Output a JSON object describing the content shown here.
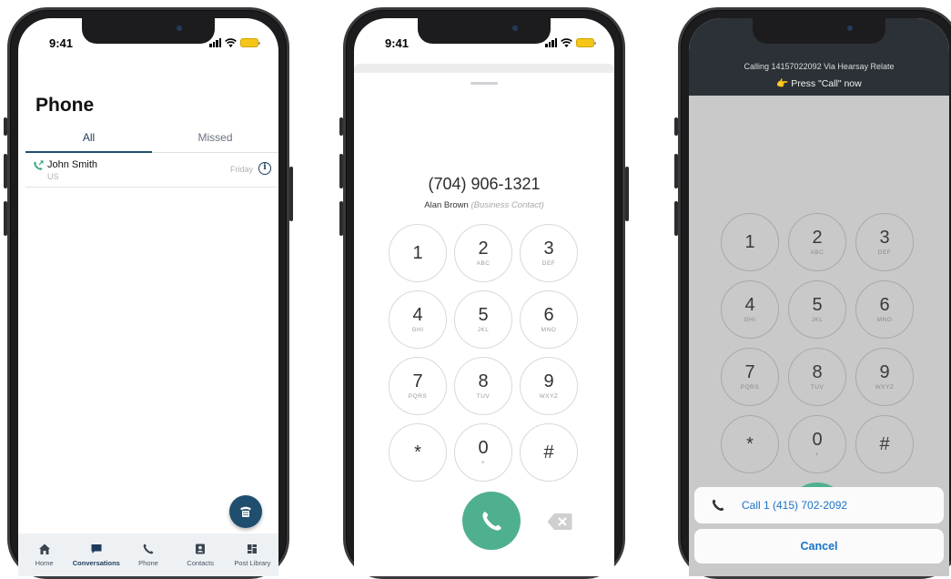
{
  "screen1": {
    "time": "9:41",
    "title": "Phone",
    "tabs": [
      {
        "label": "All"
      },
      {
        "label": "Missed"
      }
    ],
    "calls": [
      {
        "name": "John Smith",
        "subtitle": "US",
        "day": "Friday"
      }
    ],
    "fab_icon": "dialpad-icon",
    "nav": [
      {
        "label": "Home",
        "icon": "home-icon"
      },
      {
        "label": "Conversations",
        "icon": "chat-icon"
      },
      {
        "label": "Phone",
        "icon": "phone-icon"
      },
      {
        "label": "Contacts",
        "icon": "contacts-icon"
      },
      {
        "label": "Post Library",
        "icon": "grid-icon"
      }
    ],
    "active_nav": "Conversations",
    "accent": "#1d4f6e"
  },
  "screen2": {
    "time": "9:41",
    "number": "(704) 906-1321",
    "contact_name": "Alan Brown",
    "contact_type": "(Business Contact)",
    "keys": [
      {
        "d": "1",
        "l": ""
      },
      {
        "d": "2",
        "l": "ABC"
      },
      {
        "d": "3",
        "l": "DEF"
      },
      {
        "d": "4",
        "l": "GHI"
      },
      {
        "d": "5",
        "l": "JKL"
      },
      {
        "d": "6",
        "l": "MNO"
      },
      {
        "d": "7",
        "l": "PQRS"
      },
      {
        "d": "8",
        "l": "TUV"
      },
      {
        "d": "9",
        "l": "WXYZ"
      },
      {
        "d": "*",
        "l": ""
      },
      {
        "d": "0",
        "l": "+"
      },
      {
        "d": "#",
        "l": ""
      }
    ],
    "call_color": "#4fb08f"
  },
  "screen3": {
    "calling_text": "Calling 14157022092 Via Hearsay Relate",
    "press_text": "👉 Press \"Call\" now",
    "keys": [
      {
        "d": "1",
        "l": ""
      },
      {
        "d": "2",
        "l": "ABC"
      },
      {
        "d": "3",
        "l": "DEF"
      },
      {
        "d": "4",
        "l": "GHI"
      },
      {
        "d": "5",
        "l": "JKL"
      },
      {
        "d": "6",
        "l": "MNO"
      },
      {
        "d": "7",
        "l": "PQRS"
      },
      {
        "d": "8",
        "l": "TUV"
      },
      {
        "d": "9",
        "l": "WXYZ"
      },
      {
        "d": "*",
        "l": ""
      },
      {
        "d": "0",
        "l": "+"
      },
      {
        "d": "#",
        "l": ""
      }
    ],
    "call_option": "Call 1 (415) 702-2092",
    "cancel_label": "Cancel",
    "action_color": "#1a73c8"
  }
}
